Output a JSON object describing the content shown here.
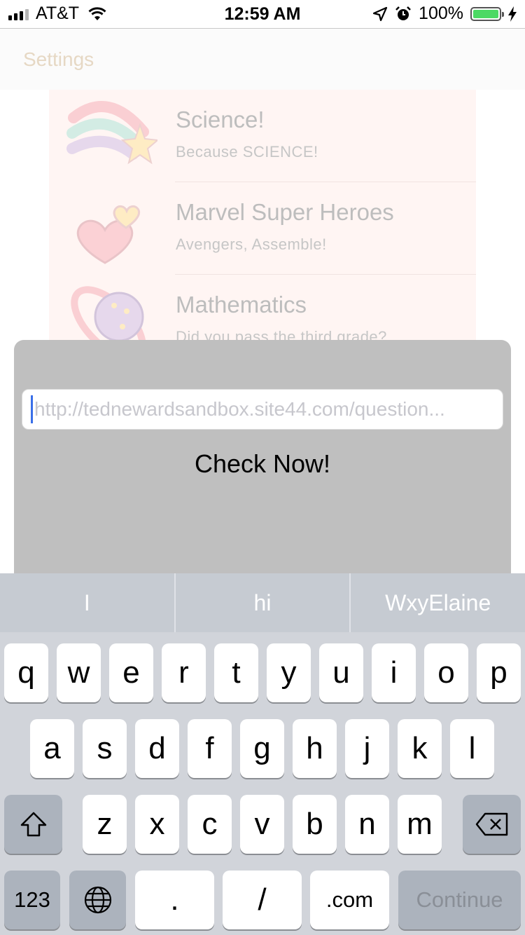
{
  "status_bar": {
    "carrier": "AT&T",
    "time": "12:59 AM",
    "battery_percent": "100%",
    "battery_level": 1.0,
    "icons": [
      "signal-icon",
      "wifi-icon",
      "location-arrow-icon",
      "alarm-icon",
      "battery-icon",
      "charging-bolt-icon"
    ]
  },
  "nav": {
    "settings_label": "Settings"
  },
  "quizzes": [
    {
      "title": "Science!",
      "description": "Because SCIENCE!",
      "icon": "shooting-star-icon"
    },
    {
      "title": "Marvel Super Heroes",
      "description": "Avengers, Assemble!",
      "icon": "hearts-icon"
    },
    {
      "title": "Mathematics",
      "description": "Did you pass the third grade?",
      "icon": "planet-icon"
    }
  ],
  "popup": {
    "url_placeholder": "http://tednewardsandbox.site44.com/question...",
    "check_button_label": "Check Now!"
  },
  "keyboard": {
    "suggestions": [
      "I",
      "hi",
      "WxyElaine"
    ],
    "row1": [
      "q",
      "w",
      "e",
      "r",
      "t",
      "y",
      "u",
      "i",
      "o",
      "p"
    ],
    "row2": [
      "a",
      "s",
      "d",
      "f",
      "g",
      "h",
      "j",
      "k",
      "l"
    ],
    "row3": [
      "z",
      "x",
      "c",
      "v",
      "b",
      "n",
      "m"
    ],
    "bottom": {
      "numbers_label": "123",
      "period_label": ".",
      "slash_label": "/",
      "dotcom_label": ".com",
      "continue_label": "Continue"
    }
  },
  "colors": {
    "accent_caret": "#3a6fe8",
    "battery_green": "#4cd964",
    "popup_bg": "#bfbfbf",
    "keyboard_bg": "#d1d4da"
  }
}
